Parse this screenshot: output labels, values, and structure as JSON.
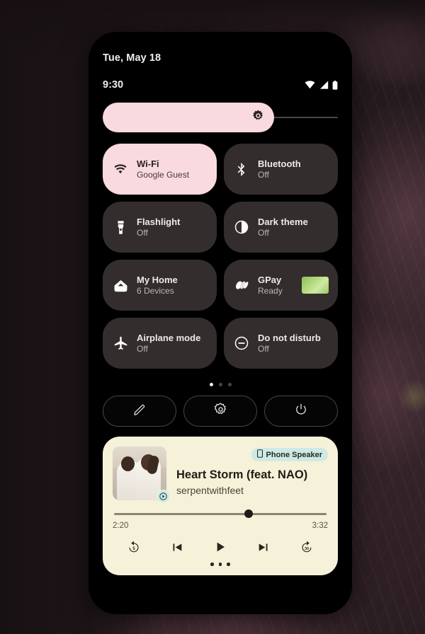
{
  "statusbar": {
    "date": "Tue, May 18",
    "clock": "9:30",
    "icons": [
      "wifi-icon",
      "cellular-signal-icon",
      "battery-icon"
    ]
  },
  "brightness": {
    "icon": "brightness-sun-icon",
    "level_percent": 73
  },
  "tiles": [
    {
      "label": "Wi-Fi",
      "sub": "Google Guest",
      "icon": "wifi-icon",
      "active": true,
      "thumb": false
    },
    {
      "label": "Bluetooth",
      "sub": "Off",
      "icon": "bluetooth-icon",
      "active": false,
      "thumb": false
    },
    {
      "label": "Flashlight",
      "sub": "Off",
      "icon": "flashlight-icon",
      "active": false,
      "thumb": false
    },
    {
      "label": "Dark theme",
      "sub": "Off",
      "icon": "dark-theme-icon",
      "active": false,
      "thumb": false
    },
    {
      "label": "My Home",
      "sub": "6 Devices",
      "icon": "home-icon",
      "active": false,
      "thumb": false
    },
    {
      "label": "GPay",
      "sub": "Ready",
      "icon": "gpay-icon",
      "active": false,
      "thumb": true
    },
    {
      "label": "Airplane mode",
      "sub": "Off",
      "icon": "airplane-icon",
      "active": false,
      "thumb": false
    },
    {
      "label": "Do not disturb",
      "sub": "Off",
      "icon": "do-not-disturb-icon",
      "active": false,
      "thumb": false
    }
  ],
  "page_dots": {
    "count": 3,
    "active_index": 0
  },
  "footer_buttons": [
    {
      "name": "edit-tiles-button",
      "icon": "pencil-icon"
    },
    {
      "name": "settings-button",
      "icon": "gear-icon"
    },
    {
      "name": "power-button",
      "icon": "power-icon"
    }
  ],
  "media": {
    "speaker_chip": "Phone Speaker",
    "speaker_icon": "phone-device-icon",
    "title": "Heart Storm (feat. NAO)",
    "artist": "serpentwithfeet",
    "album_art_badge": "play-badge-icon",
    "elapsed": "2:20",
    "duration": "3:32",
    "progress_percent": 63,
    "controls": [
      {
        "name": "replay-5-button",
        "icon": "replay-5-icon"
      },
      {
        "name": "previous-button",
        "icon": "skip-previous-icon"
      },
      {
        "name": "play-button",
        "icon": "play-icon"
      },
      {
        "name": "next-button",
        "icon": "skip-next-icon"
      },
      {
        "name": "forward-30-button",
        "icon": "forward-30-icon"
      }
    ],
    "card_dots": {
      "count": 3,
      "active_index": 0
    }
  },
  "colors": {
    "accent_pink": "#F8DADF",
    "tile_bg": "#332E2D",
    "media_card_bg": "#F6F1D9",
    "chip_teal": "#CFEAE4",
    "gpay_green": "#9BC95F"
  }
}
